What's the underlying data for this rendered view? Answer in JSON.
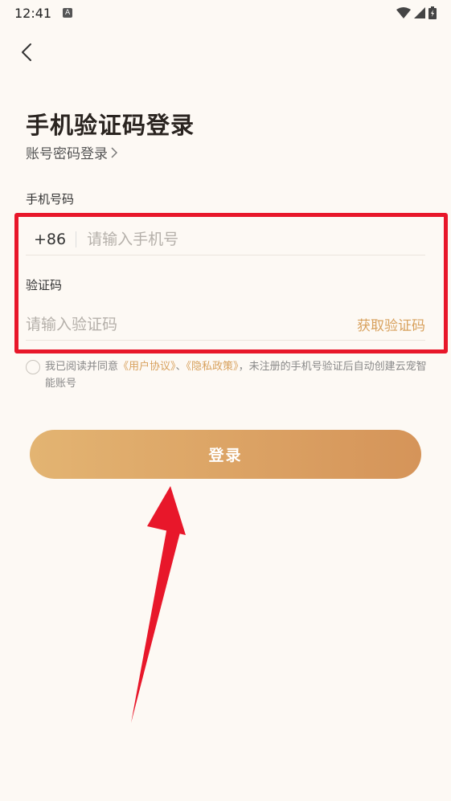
{
  "status_bar": {
    "time": "12:41",
    "notif_icon": "A"
  },
  "header": {
    "back_icon": "chevron-left-icon"
  },
  "title": "手机验证码登录",
  "switch_link": "账号密码登录",
  "phone": {
    "label": "手机号码",
    "country_code": "+86",
    "placeholder": "请输入手机号",
    "value": ""
  },
  "code": {
    "label": "验证码",
    "placeholder": "请输入验证码",
    "value": "",
    "get_code_label": "获取验证码"
  },
  "agreement": {
    "prefix": "我已阅读并同意",
    "user_agreement": "《用户协议》",
    "separator": "、",
    "privacy_policy": "《隐私政策》",
    "suffix": "，未注册的手机号验证后自动创建云宠智能账号",
    "checked": false
  },
  "login_button": "登录",
  "colors": {
    "background": "#fdf9f4",
    "accent": "#d8a15d",
    "button_start": "#e3b472",
    "button_end": "#d59459",
    "annotation": "#e8172a"
  }
}
